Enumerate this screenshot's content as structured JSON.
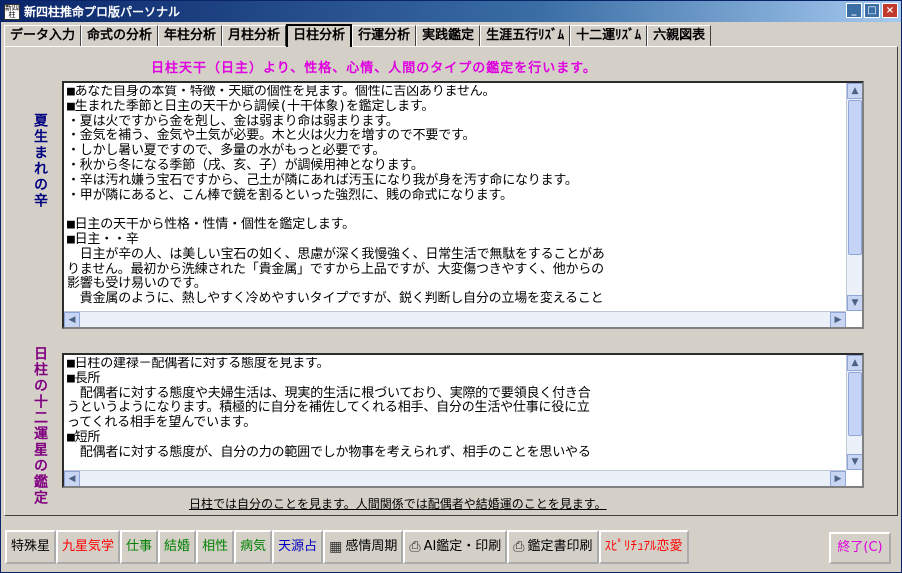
{
  "window": {
    "title": "新四柱推命プロ版パーソナル",
    "icon_text": "新四柱"
  },
  "tabs": [
    {
      "label": "データ入力",
      "active": false
    },
    {
      "label": "命式の分析",
      "active": false
    },
    {
      "label": "年柱分析",
      "active": false
    },
    {
      "label": "月柱分析",
      "active": false
    },
    {
      "label": "日柱分析",
      "active": true
    },
    {
      "label": "行運分析",
      "active": false
    },
    {
      "label": "実践鑑定",
      "active": false
    },
    {
      "label": "生涯五行ﾘｽﾞﾑ",
      "active": false
    },
    {
      "label": "十二運ﾘｽﾞﾑ",
      "active": false
    },
    {
      "label": "六親図表",
      "active": false
    }
  ],
  "main": {
    "heading": "日柱天干（日主）より、性格、心情、人間のタイプの鑑定を行います。",
    "label_top": "夏生まれの辛",
    "label_bottom": "日柱の十二運星の鑑定",
    "text_top": "■あなた自身の本質・特徴・天賦の個性を見ます。個性に吉凶ありません。\n■生まれた季節と日主の天干から調候(十干体象)を鑑定します。\n・夏は火ですから金を剋し、金は弱まり命は弱まります。\n・金気を補う、金気や土気が必要。木と火は火力を増すので不要です。\n・しかし暑い夏ですので、多量の水がもっと必要です。\n・秋から冬になる季節（戌、亥、子）が調候用神となります。\n・辛は汚れ嫌う宝石ですから、己土が隣にあれば汚玉になり我が身を汚す命になります。\n・甲が隣にあると、こん棒で鏡を割るといった強烈に、賎の命式になります。\n\n■日主の天干から性格・性情・個性を鑑定します。\n■日主・・辛\n　日主が辛の人、は美しい宝石の如く、思慮が深く我慢強く、日常生活で無駄をすることがあ\nりません。最初から洗練された「貴金属」ですから上品ですが、大変傷つきやすく、他からの\n影響も受け易いのです。\n　貴金属のように、熱しやすく冷めやすいタイプですが、鋭く判断し自分の立場を変えること",
    "text_bottom": "■日柱の建禄－配偶者に対する態度を見ます。\n■長所\n　配偶者に対する態度や夫婦生活は、現実的生活に根づいており、実際的で要領良く付き合\nうというようになります。積極的に自分を補佐してくれる相手、自分の生活や仕事に役に立\nってくれる相手を望んでいます。\n■短所\n　配偶者に対する態度が、自分の力の範囲でしか物事を考えられず、相手のことを思いやる",
    "note": "日柱では自分のことを見ます。人間関係では配偶者や結婚運のことを見ます。",
    "scroll_top_fraction": 0.75,
    "scroll_bottom_fraction": 0.55
  },
  "bottom_buttons": [
    {
      "label": "特殊星",
      "color": "#000000",
      "icon": ""
    },
    {
      "label": "九星気学",
      "color": "#ff0000",
      "icon": ""
    },
    {
      "label": "仕事",
      "color": "#008000",
      "icon": ""
    },
    {
      "label": "結婚",
      "color": "#008000",
      "icon": ""
    },
    {
      "label": "相性",
      "color": "#008000",
      "icon": ""
    },
    {
      "label": "病気",
      "color": "#008000",
      "icon": ""
    },
    {
      "label": "天源占",
      "color": "#0000c0",
      "icon": ""
    },
    {
      "label": "感情周期",
      "color": "#000000",
      "icon": "calendar-icon"
    },
    {
      "label": "AI鑑定・印刷",
      "color": "#000000",
      "icon": "printer-icon"
    },
    {
      "label": "鑑定書印刷",
      "color": "#000000",
      "icon": "printer-icon"
    },
    {
      "label": "ｽﾋﾟﾘﾁｭｱﾙ恋愛",
      "color": "#ff0000",
      "icon": ""
    }
  ],
  "exit_label": "終了(C)"
}
